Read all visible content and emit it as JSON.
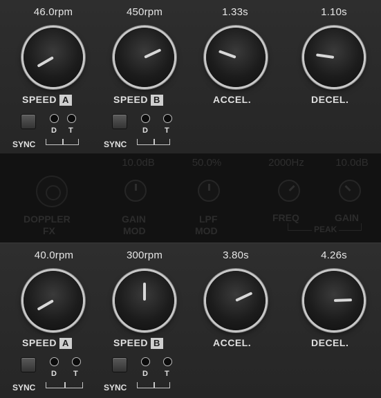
{
  "top": {
    "speed_a": {
      "value": "46.0rpm",
      "label": "SPEED",
      "badge": "A"
    },
    "speed_b": {
      "value": "450rpm",
      "label": "SPEED",
      "badge": "B"
    },
    "accel": {
      "value": "1.33s",
      "label": "ACCEL."
    },
    "decel": {
      "value": "1.10s",
      "label": "DECEL."
    },
    "sync_a": {
      "label": "SYNC",
      "d": "D",
      "t": "T"
    },
    "sync_b": {
      "label": "SYNC",
      "d": "D",
      "t": "T"
    }
  },
  "middle": {
    "doppler": {
      "line1": "DOPPLER",
      "line2": "FX"
    },
    "gain_mod": {
      "value": "10.0dB",
      "line1": "GAIN",
      "line2": "MOD"
    },
    "lpf_mod": {
      "value": "50.0%",
      "line1": "LPF",
      "line2": "MOD"
    },
    "freq": {
      "value": "2000Hz",
      "label": "FREQ"
    },
    "gain": {
      "value": "10.0dB",
      "label": "GAIN"
    },
    "peak_label": "PEAK"
  },
  "bottom": {
    "speed_a": {
      "value": "40.0rpm",
      "label": "SPEED",
      "badge": "A"
    },
    "speed_b": {
      "value": "300rpm",
      "label": "SPEED",
      "badge": "B"
    },
    "accel": {
      "value": "3.80s",
      "label": "ACCEL."
    },
    "decel": {
      "value": "4.26s",
      "label": "DECEL."
    },
    "sync_a": {
      "label": "SYNC",
      "d": "D",
      "t": "T"
    },
    "sync_b": {
      "label": "SYNC",
      "d": "D",
      "t": "T"
    }
  }
}
